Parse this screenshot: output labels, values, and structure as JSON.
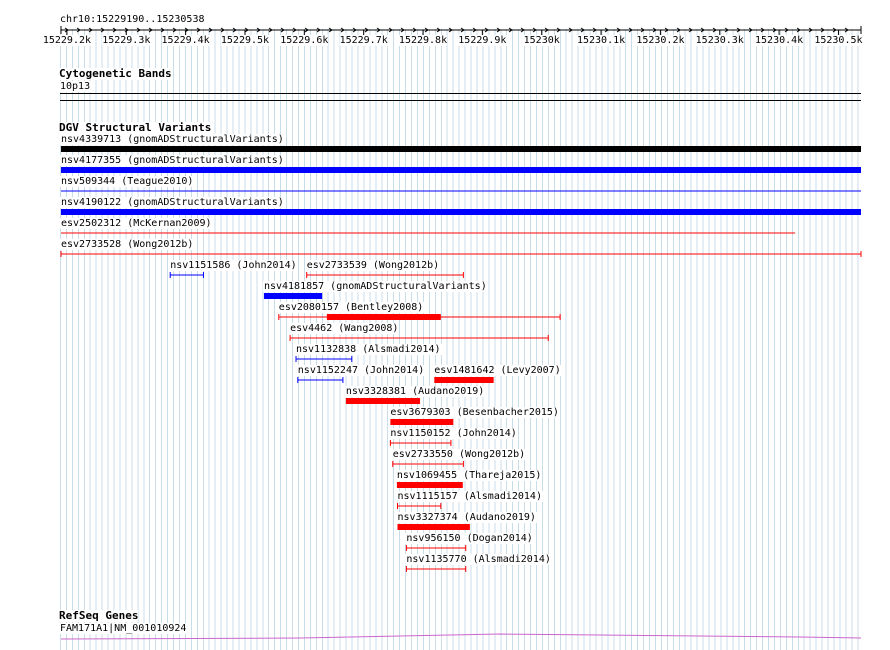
{
  "ruler": {
    "location": "chr10:15229190..15230538",
    "start": 15229190,
    "end": 15230538,
    "ticks": [
      {
        "pos": 15229200,
        "label": "15229.2k"
      },
      {
        "pos": 15229300,
        "label": "15229.3k"
      },
      {
        "pos": 15229400,
        "label": "15229.4k"
      },
      {
        "pos": 15229500,
        "label": "15229.5k"
      },
      {
        "pos": 15229600,
        "label": "15229.6k"
      },
      {
        "pos": 15229700,
        "label": "15229.7k"
      },
      {
        "pos": 15229800,
        "label": "15229.8k"
      },
      {
        "pos": 15229900,
        "label": "15229.9k"
      },
      {
        "pos": 15230000,
        "label": "15230k"
      },
      {
        "pos": 15230100,
        "label": "15230.1k"
      },
      {
        "pos": 15230200,
        "label": "15230.2k"
      },
      {
        "pos": 15230300,
        "label": "15230.3k"
      },
      {
        "pos": 15230400,
        "label": "15230.4k"
      },
      {
        "pos": 15230500,
        "label": "15230.5k"
      }
    ]
  },
  "tracks": {
    "cytoband": {
      "title": "Cytogenetic Bands",
      "feature": "10p13"
    },
    "dgv": {
      "title": "DGV Structural Variants",
      "colors": {
        "gain": "#0000ff",
        "loss": "#ff0000",
        "gainloss": "#000000"
      },
      "features": [
        {
          "label": "nsv4339713 (gnomADStructuralVariants)",
          "start": 15229190,
          "end": 15230538,
          "type": "gainloss",
          "style": "thick"
        },
        {
          "label": "nsv4177355 (gnomADStructuralVariants)",
          "start": 15229190,
          "end": 15230538,
          "type": "gain",
          "style": "thick"
        },
        {
          "label": "nsv509344 (Teague2010)",
          "start": 15229190,
          "end": 15230538,
          "type": "gain",
          "style": "line"
        },
        {
          "label": "nsv4190122 (gnomADStructuralVariants)",
          "start": 15229190,
          "end": 15230538,
          "type": "gain",
          "style": "thick"
        },
        {
          "label": "esv2502312 (McKernan2009)",
          "start": 15229190,
          "end": 15230427,
          "type": "loss",
          "style": "line"
        },
        {
          "label": "esv2733528 (Wong2012b)",
          "start": 15229190,
          "end": 15230538,
          "type": "loss",
          "style": "bracket"
        },
        {
          "label": "nsv1151586 (John2014)",
          "start": 15229374,
          "end": 15229430,
          "type": "gain",
          "style": "bracket"
        },
        {
          "label": "esv2733539 (Wong2012b)",
          "start": 15229604,
          "end": 15229868,
          "type": "loss",
          "style": "bracket"
        },
        {
          "label": "nsv4181857 (gnomADStructuralVariants)",
          "start": 15229532,
          "end": 15229630,
          "type": "gain",
          "style": "thick"
        },
        {
          "label": "esv2080157 (Bentley2008)",
          "start": 15229557,
          "end": 15230031,
          "type": "loss",
          "style": "bracket-thick",
          "thick_start": 15229638,
          "thick_end": 15229830
        },
        {
          "label": "esv4462 (Wang2008)",
          "start": 15229576,
          "end": 15230011,
          "type": "loss",
          "style": "bracket"
        },
        {
          "label": "nsv1132838 (Alsmadi2014)",
          "start": 15229586,
          "end": 15229680,
          "type": "gain",
          "style": "bracket"
        },
        {
          "label": "nsv1152247 (John2014)",
          "start": 15229589,
          "end": 15229665,
          "type": "gain",
          "style": "bracket"
        },
        {
          "label": "esv1481642 (Levy2007)",
          "start": 15229819,
          "end": 15229919,
          "type": "loss",
          "style": "thick"
        },
        {
          "label": "nsv3328381 (Audano2019)",
          "start": 15229670,
          "end": 15229795,
          "type": "loss",
          "style": "thick"
        },
        {
          "label": "esv3679303 (Besenbacher2015)",
          "start": 15229745,
          "end": 15229851,
          "type": "loss",
          "style": "thick"
        },
        {
          "label": "nsv1150152 (John2014)",
          "start": 15229745,
          "end": 15229847,
          "type": "loss",
          "style": "bracket"
        },
        {
          "label": "esv2733550 (Wong2012b)",
          "start": 15229749,
          "end": 15229868,
          "type": "loss",
          "style": "bracket"
        },
        {
          "label": "nsv1069455 (Thareja2015)",
          "start": 15229756,
          "end": 15229867,
          "type": "loss",
          "style": "thick"
        },
        {
          "label": "nsv1115157 (Alsmadi2014)",
          "start": 15229757,
          "end": 15229830,
          "type": "loss",
          "style": "bracket"
        },
        {
          "label": "nsv3327374 (Audano2019)",
          "start": 15229757,
          "end": 15229879,
          "type": "loss",
          "style": "thick"
        },
        {
          "label": "nsv956150 (Dogan2014)",
          "start": 15229772,
          "end": 15229872,
          "type": "loss",
          "style": "bracket"
        },
        {
          "label": "nsv1135770 (Alsmadi2014)",
          "start": 15229772,
          "end": 15229872,
          "type": "loss",
          "style": "bracket"
        }
      ]
    },
    "refseq": {
      "title": "RefSeq Genes",
      "feature": "FAM171A1|NM_001010924",
      "color": "#cc66cc"
    }
  }
}
